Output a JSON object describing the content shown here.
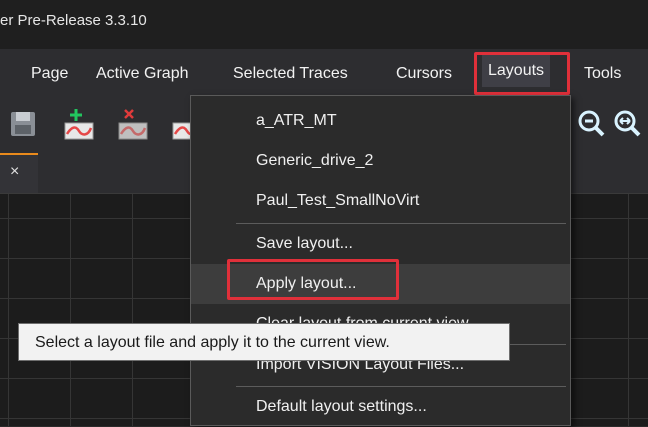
{
  "window": {
    "title": "er Pre-Release 3.3.10"
  },
  "menubar": {
    "items": [
      {
        "label": "Page"
      },
      {
        "label": "Active Graph"
      },
      {
        "label": "Selected Traces"
      },
      {
        "label": "Cursors"
      },
      {
        "label": "Layouts"
      },
      {
        "label": "Tools"
      }
    ]
  },
  "toolbar": {
    "icons": [
      "save-icon",
      "add-trace-icon",
      "remove-trace-icon",
      "trace-icon",
      "zoom-out-icon",
      "zoom-fit-icon"
    ]
  },
  "tabs": {
    "close_glyph": "×"
  },
  "layouts_menu": {
    "items": [
      {
        "label": "a_ATR_MT"
      },
      {
        "label": "Generic_drive_2"
      },
      {
        "label": "Paul_Test_SmallNoVirt"
      },
      {
        "label": "Save layout..."
      },
      {
        "label": "Apply layout..."
      },
      {
        "label": "Clear layout from current view..."
      },
      {
        "label": "Import VISION Layout Files..."
      },
      {
        "label": "Default layout settings..."
      }
    ]
  },
  "tooltip": {
    "text": "Select a layout file and apply it to the current view."
  },
  "colors": {
    "highlight": "#e0303a",
    "tab_accent": "#e98a1c",
    "add_green": "#22c55e",
    "remove_red": "#e03b3b",
    "trace_red": "#e54848",
    "zoom_cyan": "#d9f3ff"
  }
}
